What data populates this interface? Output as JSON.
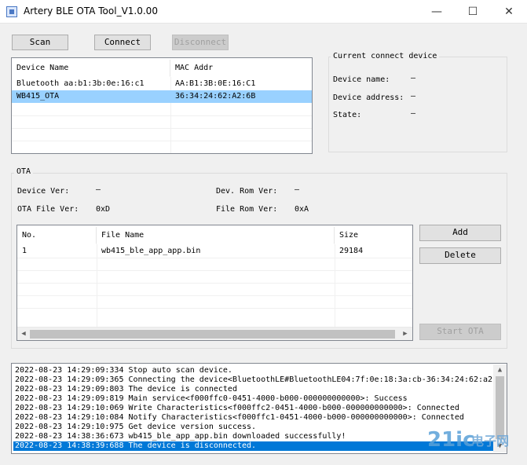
{
  "window": {
    "title": "Artery BLE OTA Tool_V1.0.00",
    "minimize": "—",
    "maximize": "☐",
    "close": "✕"
  },
  "toolbar": {
    "scan": "Scan",
    "connect": "Connect",
    "disconnect": "Disconnect"
  },
  "devices": {
    "columns": [
      "Device Name",
      "MAC Addr"
    ],
    "rows": [
      {
        "name": "Bluetooth aa:b1:3b:0e:16:c1",
        "mac": "AA:B1:3B:0E:16:C1",
        "selected": false
      },
      {
        "name": "WB415_OTA",
        "mac": "36:34:24:62:A2:6B",
        "selected": true
      }
    ]
  },
  "current_device": {
    "group_label": "Current connect device",
    "name_label": "Device name:",
    "name_value": "—",
    "address_label": "Device address:",
    "address_value": "—",
    "state_label": "State:",
    "state_value": "—"
  },
  "ota": {
    "group_label": "OTA",
    "device_ver_label": "Device Ver:",
    "device_ver_value": "—",
    "dev_rom_ver_label": "Dev. Rom Ver:",
    "dev_rom_ver_value": "—",
    "ota_file_ver_label": "OTA File Ver:",
    "ota_file_ver_value": "0xD",
    "file_rom_ver_label": "File Rom Ver:",
    "file_rom_ver_value": "0xA",
    "columns": [
      "No.",
      "File Name",
      "Size"
    ],
    "files": [
      {
        "no": "1",
        "name": "wb415_ble_app_app.bin",
        "size": "29184"
      }
    ],
    "add": "Add",
    "delete": "Delete",
    "start_ota": "Start OTA"
  },
  "log": {
    "lines": [
      "2022-08-23 14:29:09:334 Stop auto scan device.",
      "2022-08-23 14:29:09:365 Connecting the device<BluetoothLE#BluetoothLE04:7f:0e:18:3a:cb-36:34:24:62:a2:",
      "2022-08-23 14:29:09:803 The device is connected",
      "2022-08-23 14:29:09:819 Main service<f000ffc0-0451-4000-b000-000000000000>: Success",
      "2022-08-23 14:29:10:069 Write Characteristics<f000ffc2-0451-4000-b000-000000000000>: Connected",
      "2022-08-23 14:29:10:084 Notify Characteristics<f000ffc1-0451-4000-b000-000000000000>: Connected",
      "2022-08-23 14:29:10:975 Get device version success.",
      "2022-08-23 14:38:36:673 wb415_ble_app_app.bin downloaded successfully!",
      "2022-08-23 14:38:39:688 The device is disconnected."
    ],
    "selected_index": 8
  },
  "watermark": {
    "brand": "21ic",
    "tagline": "电子网"
  }
}
